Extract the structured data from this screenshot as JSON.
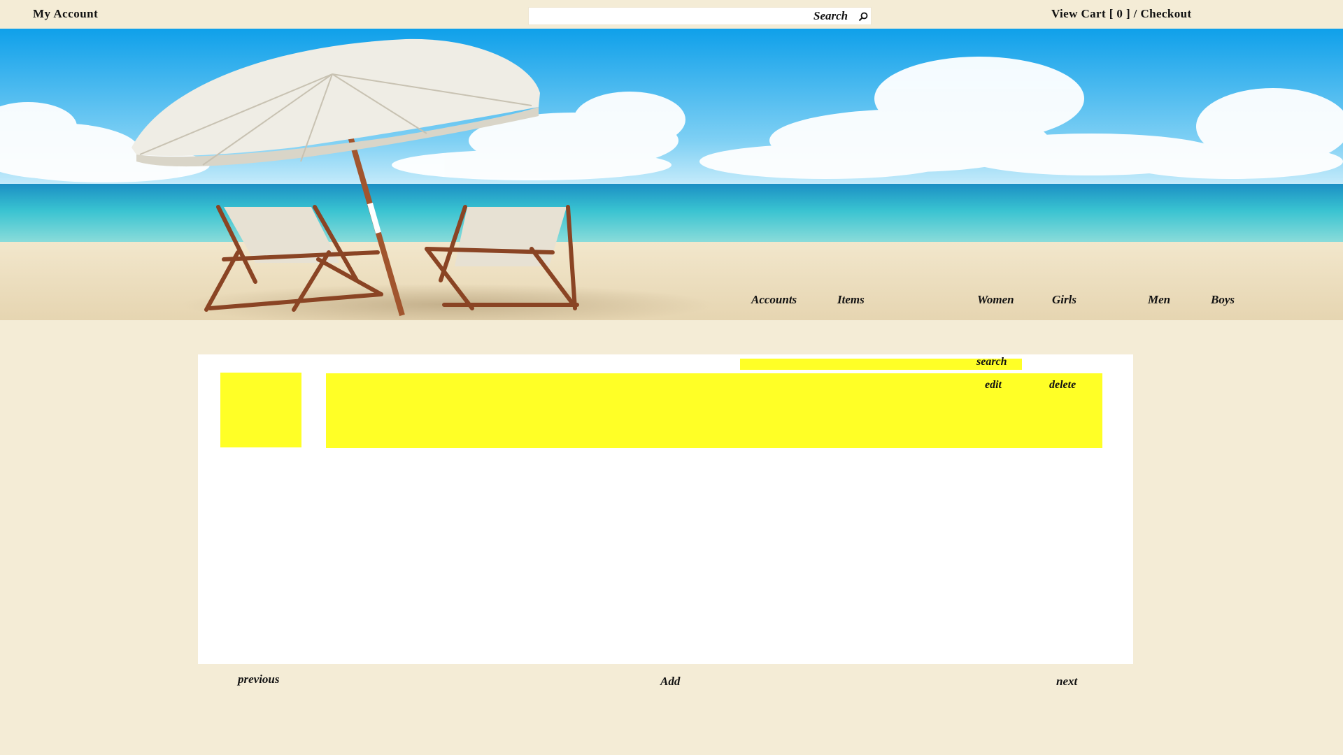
{
  "topbar": {
    "account_label": "My Account",
    "search": {
      "value": "",
      "button_label": "Search",
      "icon": "search-icon"
    },
    "cart_prefix": "View Cart",
    "cart_count": "[ 0 ]",
    "cart_separator": "/",
    "checkout_label": "Checkout"
  },
  "banner": {
    "image": "beach-scene",
    "nav": [
      "Accounts",
      "Items",
      "Women",
      "Girls",
      "Men",
      "Boys"
    ]
  },
  "panel": {
    "filter": {
      "value": "",
      "button_label": "search"
    },
    "rows": [
      {
        "edit_label": "edit",
        "delete_label": "delete"
      }
    ]
  },
  "footer": {
    "previous_label": "previous",
    "add_label": "Add",
    "next_label": "next"
  },
  "colors": {
    "page_background": "#f4ecd6",
    "panel_background": "#ffffff",
    "highlight": "#ffff26",
    "sky_top": "#16a6e8",
    "sea": "#3fc7d3",
    "sand": "#efe2c4"
  }
}
